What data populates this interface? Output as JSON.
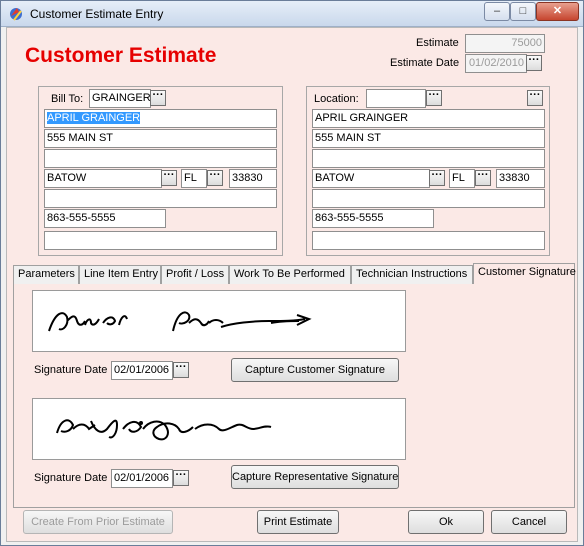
{
  "window": {
    "title": "Customer Estimate Entry",
    "minimize": "–",
    "maximize": "□",
    "close": "✕"
  },
  "header": {
    "heading": "Customer Estimate",
    "estimate_label": "Estimate",
    "estimate_value": "75000",
    "estimate_date_label": "Estimate Date",
    "estimate_date_value": "01/02/2010"
  },
  "bill_to": {
    "label": "Bill To:",
    "code": "GRAINGER",
    "name": "APRIL GRAINGER",
    "address1": "555 MAIN ST",
    "address2": "",
    "city": "BATOW",
    "state": "FL",
    "zip": "33830",
    "extra": "",
    "phone": "863-555-5555",
    "extra2": ""
  },
  "location": {
    "label": "Location:",
    "code": "",
    "name": "APRIL GRAINGER",
    "address1": "555 MAIN ST",
    "address2": "",
    "city": "BATOW",
    "state": "FL",
    "zip": "33830",
    "extra": "",
    "phone": "863-555-5555",
    "extra2": ""
  },
  "lookup_glyph": "···",
  "tabs": [
    {
      "label": "Parameters"
    },
    {
      "label": "Line Item Entry"
    },
    {
      "label": "Profit / Loss"
    },
    {
      "label": "Work To Be Performed"
    },
    {
      "label": "Technician Instructions"
    },
    {
      "label": "Customer Signature"
    }
  ],
  "customer_signature": {
    "date_label": "Signature Date",
    "date_value": "02/01/2006",
    "button": "Capture Customer Signature"
  },
  "rep_signature": {
    "date_label": "Signature Date",
    "date_value": "02/01/2006",
    "button": "Capture Representative Signature"
  },
  "footer": {
    "create_prior": "Create From Prior Estimate",
    "print": "Print Estimate",
    "ok": "Ok",
    "cancel": "Cancel"
  },
  "colors": {
    "heading": "#e60000",
    "panel": "#fbe9e6",
    "selection": "#3399ff"
  }
}
